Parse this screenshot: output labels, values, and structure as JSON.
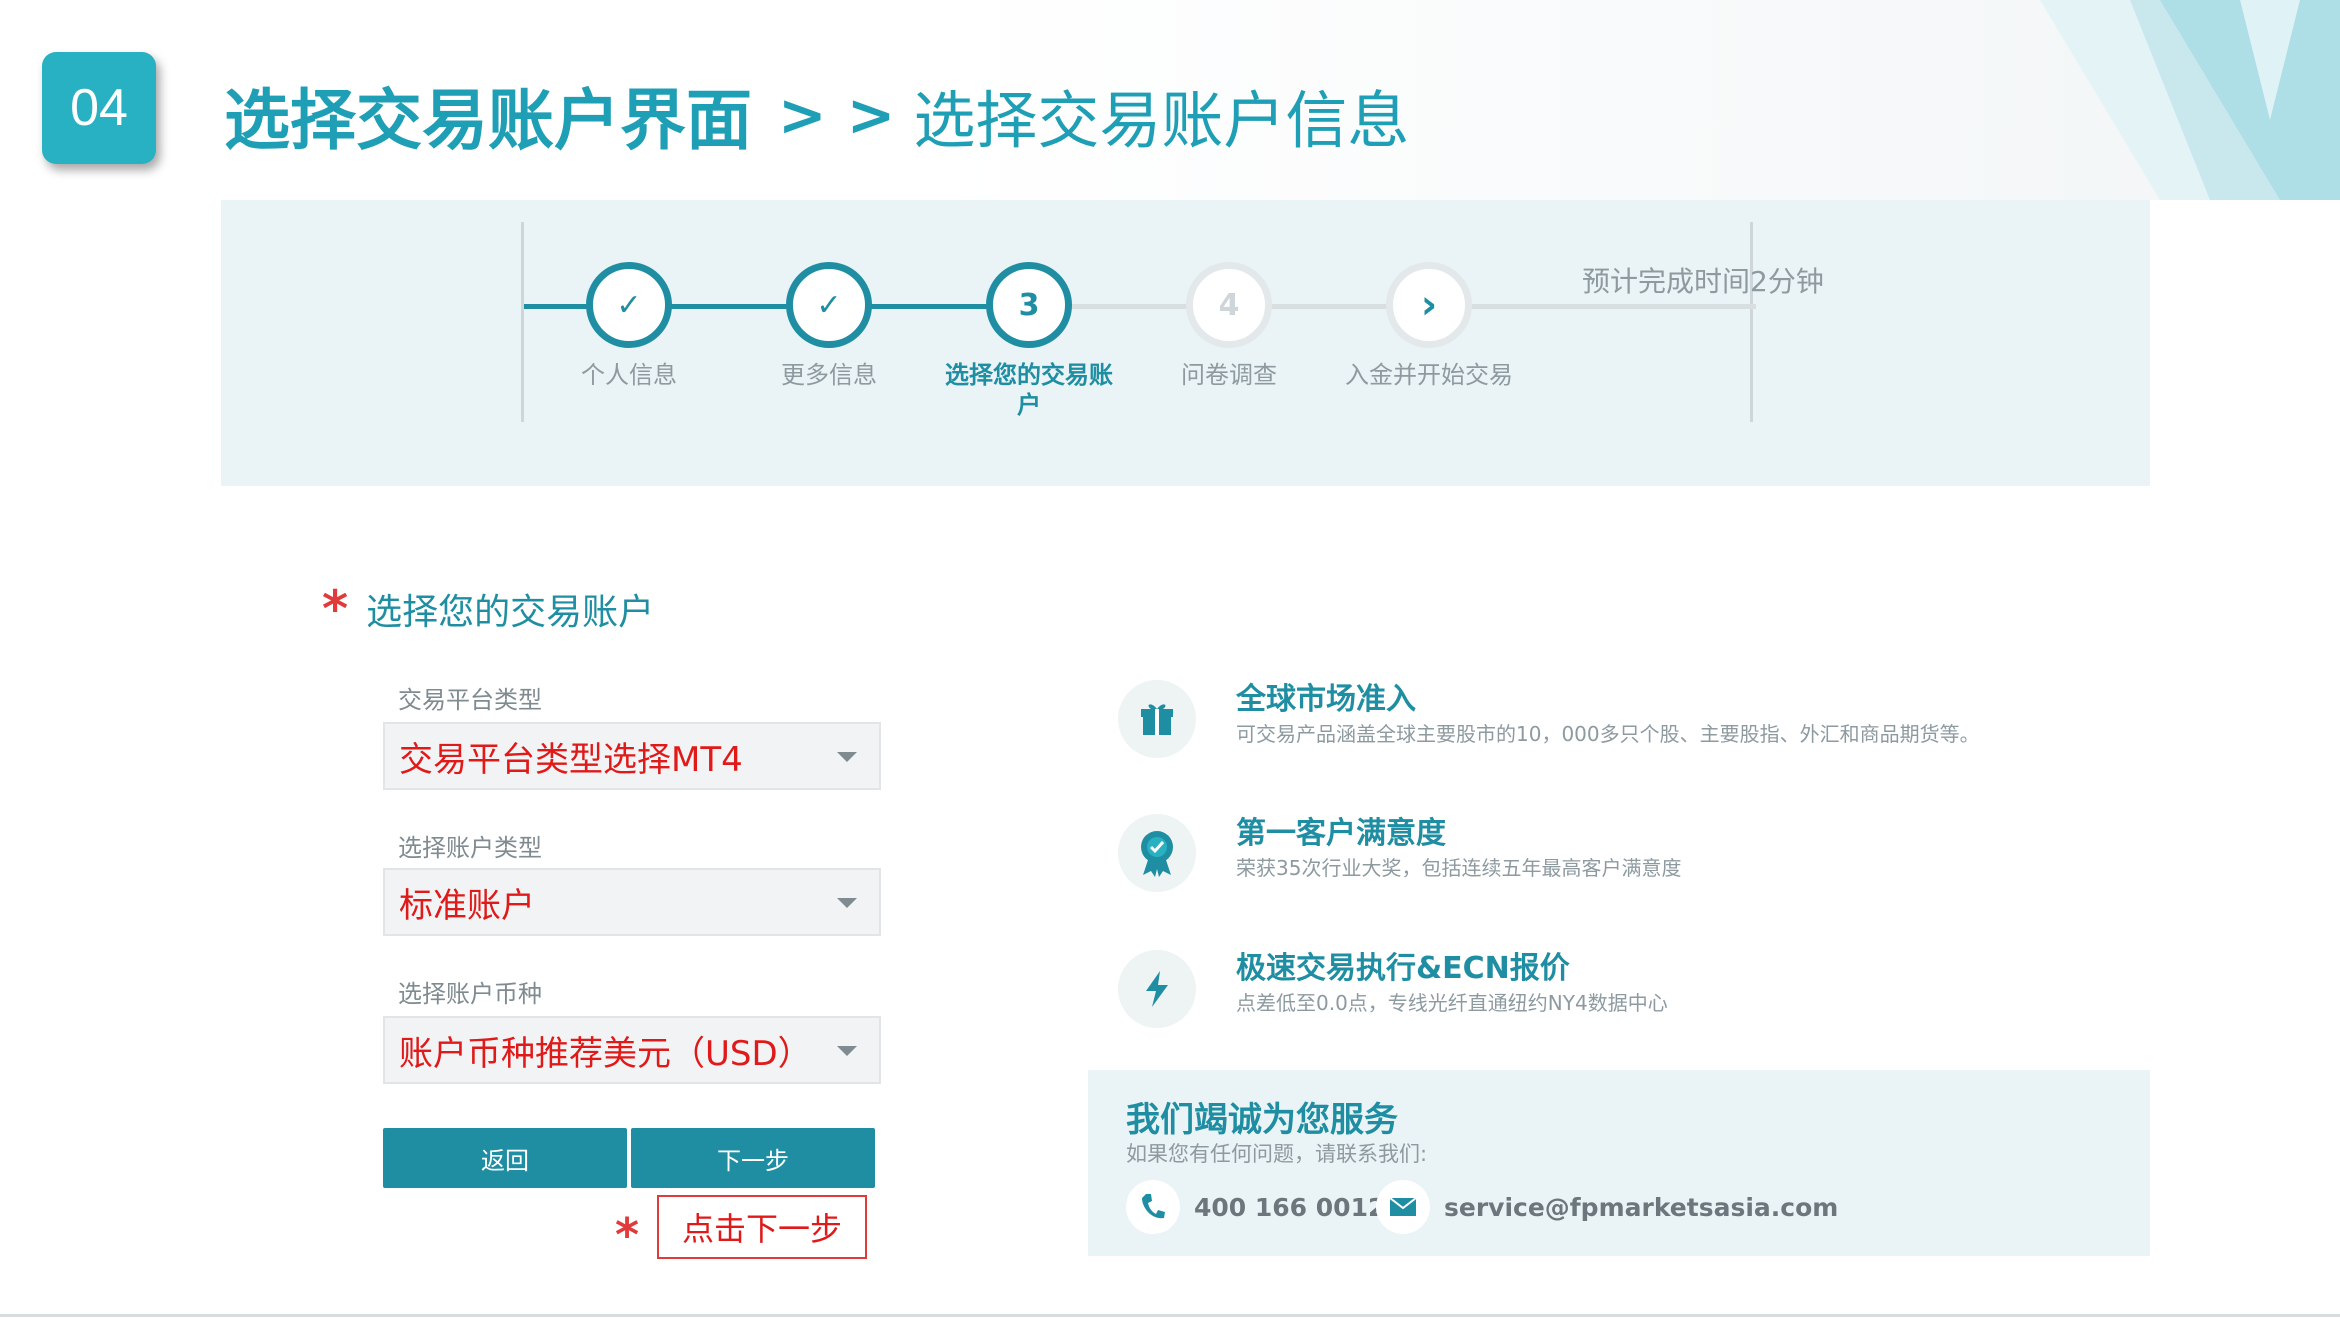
{
  "header": {
    "badge": "04",
    "title_main": "选择交易账户界面",
    "title_arrows": "> >",
    "title_sub": "选择交易账户信息"
  },
  "progress": {
    "steps": [
      {
        "label": "个人信息",
        "state": "done",
        "marker": "✓"
      },
      {
        "label": "更多信息",
        "state": "done",
        "marker": "✓"
      },
      {
        "label": "选择您的交易账户",
        "state": "active",
        "marker": "3"
      },
      {
        "label": "问卷调查",
        "state": "todo",
        "marker": "4"
      },
      {
        "label": "入金并开始交易",
        "state": "todo",
        "marker": "›"
      }
    ],
    "eta": "预计完成时间2分钟"
  },
  "form": {
    "star": "*",
    "section_title": "选择您的交易账户",
    "platform_label": "交易平台类型",
    "platform_value": "交易平台类型选择MT4",
    "account_type_label": "选择账户类型",
    "account_type_value": "标准账户",
    "currency_label": "选择账户币种",
    "currency_value": "账户币种推荐美元（USD）",
    "back_button": "返回",
    "next_button": "下一步",
    "hint_star": "*",
    "hint_text": "点击下一步"
  },
  "features": [
    {
      "icon": "gift-icon",
      "title": "全球市场准入",
      "desc": "可交易产品涵盖全球主要股市的10，000多只个股、主要股指、外汇和商品期货等。"
    },
    {
      "icon": "award-ribbon-icon",
      "title": "第一客户满意度",
      "desc": "荣获35次行业大奖，包括连续五年最高客户满意度"
    },
    {
      "icon": "lightning-icon",
      "title": "极速交易执行&ECN报价",
      "desc": "点差低至0.0点，专线光纤直通纽约NY4数据中心"
    }
  ],
  "contact": {
    "title": "我们竭诚为您服务",
    "subtitle": "如果您有任何问题，请联系我们:",
    "phone": "400 166 0012",
    "email": "service@fpmarketsasia.com"
  },
  "colors": {
    "accent": "#1f8ea3",
    "badge": "#27b1c3",
    "highlight_red": "#e01919",
    "panel_bg": "#eaf3f6"
  }
}
